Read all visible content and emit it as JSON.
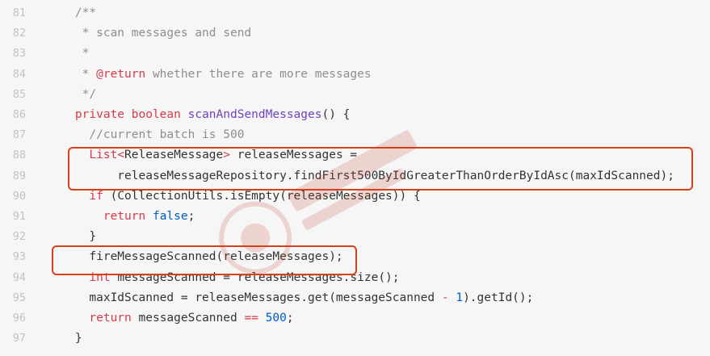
{
  "editor": {
    "lines": [
      {
        "num": "81",
        "tokens": [
          {
            "t": "    /**",
            "c": "comment"
          }
        ]
      },
      {
        "num": "82",
        "tokens": [
          {
            "t": "     * scan messages and send",
            "c": "comment"
          }
        ]
      },
      {
        "num": "83",
        "tokens": [
          {
            "t": "     *",
            "c": "comment"
          }
        ]
      },
      {
        "num": "84",
        "tokens": [
          {
            "t": "     * ",
            "c": "comment"
          },
          {
            "t": "@return",
            "c": "doctag"
          },
          {
            "t": " whether there are more messages",
            "c": "comment"
          }
        ]
      },
      {
        "num": "85",
        "tokens": [
          {
            "t": "     */",
            "c": "comment"
          }
        ]
      },
      {
        "num": "86",
        "tokens": [
          {
            "t": "    ",
            "c": "default"
          },
          {
            "t": "private boolean",
            "c": "keyword"
          },
          {
            "t": " ",
            "c": "default"
          },
          {
            "t": "scanAndSendMessages",
            "c": "fn"
          },
          {
            "t": "() {",
            "c": "default"
          }
        ]
      },
      {
        "num": "87",
        "tokens": [
          {
            "t": "      //current batch is 500",
            "c": "comment"
          }
        ]
      },
      {
        "num": "88",
        "tokens": [
          {
            "t": "      ",
            "c": "default"
          },
          {
            "t": "List",
            "c": "keyword"
          },
          {
            "t": "<",
            "c": "op"
          },
          {
            "t": "ReleaseMessage",
            "c": "default"
          },
          {
            "t": ">",
            "c": "op"
          },
          {
            "t": " releaseMessages =",
            "c": "default"
          }
        ]
      },
      {
        "num": "89",
        "tokens": [
          {
            "t": "          releaseMessageRepository.findFirst500ByIdGreaterThanOrderByIdAsc(maxIdScanned);",
            "c": "default"
          }
        ]
      },
      {
        "num": "90",
        "tokens": [
          {
            "t": "      ",
            "c": "default"
          },
          {
            "t": "if",
            "c": "keyword"
          },
          {
            "t": " (CollectionUtils.isEmpty(releaseMessages)) {",
            "c": "default"
          }
        ]
      },
      {
        "num": "91",
        "tokens": [
          {
            "t": "        ",
            "c": "default"
          },
          {
            "t": "return",
            "c": "keyword"
          },
          {
            "t": " ",
            "c": "default"
          },
          {
            "t": "false",
            "c": "num"
          },
          {
            "t": ";",
            "c": "default"
          }
        ]
      },
      {
        "num": "92",
        "tokens": [
          {
            "t": "      }",
            "c": "default"
          }
        ]
      },
      {
        "num": "93",
        "tokens": [
          {
            "t": "      fireMessageScanned(releaseMessages);",
            "c": "default"
          }
        ]
      },
      {
        "num": "94",
        "tokens": [
          {
            "t": "      ",
            "c": "default"
          },
          {
            "t": "int",
            "c": "keyword"
          },
          {
            "t": " messageScanned = releaseMessages.size();",
            "c": "default"
          }
        ]
      },
      {
        "num": "95",
        "tokens": [
          {
            "t": "      maxIdScanned = releaseMessages.get(messageScanned ",
            "c": "default"
          },
          {
            "t": "-",
            "c": "op"
          },
          {
            "t": " ",
            "c": "default"
          },
          {
            "t": "1",
            "c": "num"
          },
          {
            "t": ").getId();",
            "c": "default"
          }
        ]
      },
      {
        "num": "96",
        "tokens": [
          {
            "t": "      ",
            "c": "default"
          },
          {
            "t": "return",
            "c": "keyword"
          },
          {
            "t": " messageScanned ",
            "c": "default"
          },
          {
            "t": "==",
            "c": "op"
          },
          {
            "t": " ",
            "c": "default"
          },
          {
            "t": "500",
            "c": "num"
          },
          {
            "t": ";",
            "c": "default"
          }
        ]
      },
      {
        "num": "97",
        "tokens": [
          {
            "t": "    }",
            "c": "default"
          }
        ]
      }
    ]
  },
  "colors": {
    "background": "#f6f6f6",
    "line_number": "#c2c2c2",
    "comment": "#8e8e8e",
    "keyword": "#d73a49",
    "function": "#6f42c1",
    "number": "#005cc5",
    "highlight_box": "#d9401a"
  },
  "highlights": [
    {
      "label": "release-messages-query",
      "lines": [
        "88",
        "89"
      ]
    },
    {
      "label": "fire-message-scanned",
      "lines": [
        "93"
      ]
    }
  ]
}
